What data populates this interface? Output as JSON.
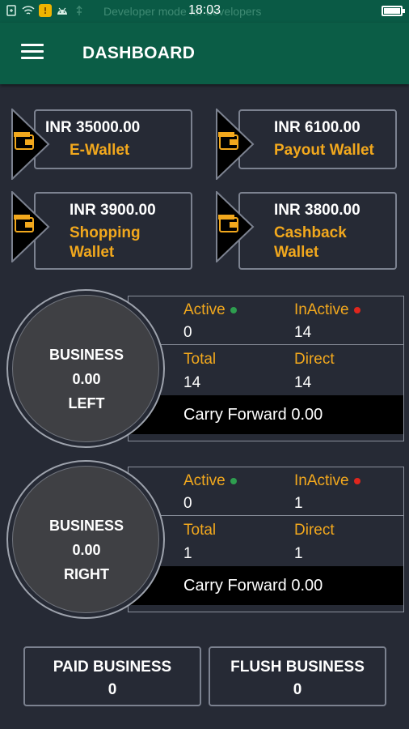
{
  "status_bar": {
    "developer_text": "Developer mode for developers",
    "time": "18:03",
    "icons": [
      "usb-debug-icon",
      "wifi-icon",
      "notification-icon",
      "android-icon",
      "usb-icon",
      "battery-icon"
    ],
    "notification_glyph": "!"
  },
  "app_bar": {
    "title": "DASHBOARD",
    "menu_icon": "hamburger-menu-icon"
  },
  "wallets": [
    {
      "amount": "INR 35000.00",
      "name": "E-Wallet",
      "icon": "wallet-icon"
    },
    {
      "amount": "INR 6100.00",
      "name": "Payout Wallet",
      "icon": "wallet-icon"
    },
    {
      "amount": "INR 3900.00",
      "name": "Shopping Wallet",
      "icon": "wallet-icon"
    },
    {
      "amount": "INR 3800.00",
      "name": "Cashback Wallet",
      "icon": "wallet-icon"
    }
  ],
  "business": [
    {
      "title": "BUSINESS",
      "amount": "0.00",
      "side": "LEFT",
      "active_label": "Active",
      "active_value": "0",
      "inactive_label": "InActive",
      "inactive_value": "14",
      "total_label": "Total",
      "total_value": "14",
      "direct_label": "Direct",
      "direct_value": "14",
      "carry_forward": "Carry Forward 0.00"
    },
    {
      "title": "BUSINESS",
      "amount": "0.00",
      "side": "RIGHT",
      "active_label": "Active",
      "active_value": "0",
      "inactive_label": "InActive",
      "inactive_value": "1",
      "total_label": "Total",
      "total_value": "1",
      "direct_label": "Direct",
      "direct_value": "1",
      "carry_forward": "Carry Forward 0.00"
    }
  ],
  "bottom": {
    "paid_label": "PAID BUSINESS",
    "paid_value": "0",
    "flush_label": "FLUSH BUSINESS",
    "flush_value": "0"
  },
  "colors": {
    "background": "#262a35",
    "app_bar": "#0b5d46",
    "accent": "#f2a81d",
    "active_dot": "#2e9e4f",
    "inactive_dot": "#e0261d",
    "card_border": "#7c8290"
  }
}
